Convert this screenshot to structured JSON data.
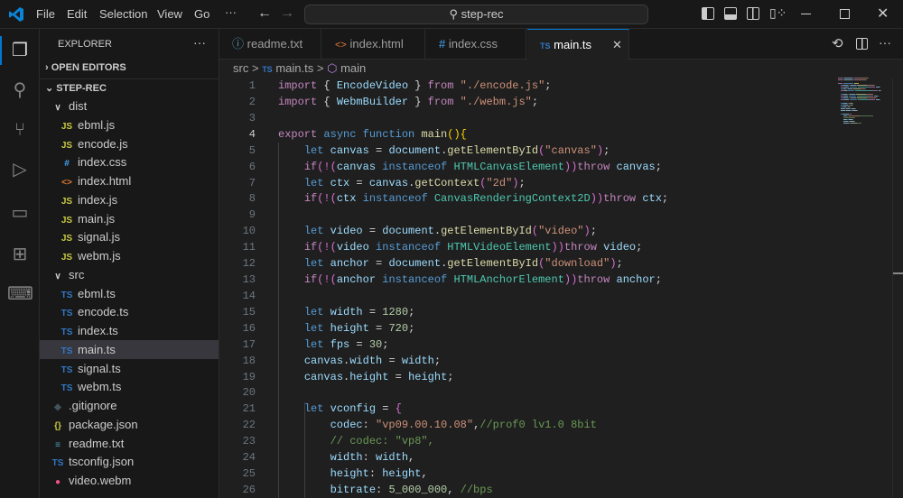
{
  "titlebar": {
    "menus": [
      "File",
      "Edit",
      "Selection",
      "View",
      "Go",
      "···"
    ],
    "search": "step-rec"
  },
  "sidebar": {
    "title": "EXPLORER",
    "more": "···",
    "open_editors": "OPEN EDITORS",
    "project": "STEP-REC",
    "tree": [
      {
        "label": "dist",
        "kind": "folder",
        "depth": 1,
        "icon": "∨"
      },
      {
        "label": "ebml.js",
        "kind": "js",
        "depth": 2,
        "icon": "JS"
      },
      {
        "label": "encode.js",
        "kind": "js",
        "depth": 2,
        "icon": "JS"
      },
      {
        "label": "index.css",
        "kind": "css",
        "depth": 2,
        "icon": "#"
      },
      {
        "label": "index.html",
        "kind": "html",
        "depth": 2,
        "icon": "<>"
      },
      {
        "label": "index.js",
        "kind": "js",
        "depth": 2,
        "icon": "JS"
      },
      {
        "label": "main.js",
        "kind": "js",
        "depth": 2,
        "icon": "JS"
      },
      {
        "label": "signal.js",
        "kind": "js",
        "depth": 2,
        "icon": "JS"
      },
      {
        "label": "webm.js",
        "kind": "js",
        "depth": 2,
        "icon": "JS"
      },
      {
        "label": "src",
        "kind": "folder",
        "depth": 1,
        "icon": "∨"
      },
      {
        "label": "ebml.ts",
        "kind": "ts",
        "depth": 2,
        "icon": "TS"
      },
      {
        "label": "encode.ts",
        "kind": "ts",
        "depth": 2,
        "icon": "TS"
      },
      {
        "label": "index.ts",
        "kind": "ts",
        "depth": 2,
        "icon": "TS"
      },
      {
        "label": "main.ts",
        "kind": "ts",
        "depth": 2,
        "icon": "TS",
        "selected": true
      },
      {
        "label": "signal.ts",
        "kind": "ts",
        "depth": 2,
        "icon": "TS"
      },
      {
        "label": "webm.ts",
        "kind": "ts",
        "depth": 2,
        "icon": "TS"
      },
      {
        "label": ".gitignore",
        "kind": "git",
        "depth": 1,
        "icon": "◆"
      },
      {
        "label": "package.json",
        "kind": "json",
        "depth": 1,
        "icon": "{}"
      },
      {
        "label": "readme.txt",
        "kind": "txt",
        "depth": 1,
        "icon": "≡"
      },
      {
        "label": "tsconfig.json",
        "kind": "tsjson",
        "depth": 1,
        "icon": "TS"
      },
      {
        "label": "video.webm",
        "kind": "video",
        "depth": 1,
        "icon": "●"
      }
    ]
  },
  "tabs": [
    {
      "label": "readme.txt",
      "icon": "ⓘ"
    },
    {
      "label": "index.html",
      "icon": "<>"
    },
    {
      "label": "index.css",
      "icon": "#"
    },
    {
      "label": "main.ts",
      "icon": "TS",
      "active": true,
      "close": "✕"
    }
  ],
  "breadcrumb": {
    "folder": "src",
    "file": "main.ts",
    "symbol": "main",
    "sep": ">"
  },
  "colors": {
    "accent": "#0078d4",
    "js": "#cbcb41",
    "ts": "#3178c6",
    "css": "#42a5f5",
    "html": "#e37933"
  },
  "code": {
    "lines": [
      [
        [
          "c",
          "import"
        ],
        [
          "p",
          " { "
        ],
        [
          "v",
          "EncodeVideo"
        ],
        [
          "p",
          " } "
        ],
        [
          "c",
          "from"
        ],
        [
          "p",
          " "
        ],
        [
          "s",
          "\"./encode.js\""
        ],
        [
          "p",
          ";"
        ]
      ],
      [
        [
          "c",
          "import"
        ],
        [
          "p",
          " { "
        ],
        [
          "v",
          "WebmBuilder"
        ],
        [
          "p",
          " } "
        ],
        [
          "c",
          "from"
        ],
        [
          "p",
          " "
        ],
        [
          "s",
          "\"./webm.js\""
        ],
        [
          "p",
          ";"
        ]
      ],
      [],
      [
        [
          "c",
          "export"
        ],
        [
          "p",
          " "
        ],
        [
          "k",
          "async"
        ],
        [
          "p",
          " "
        ],
        [
          "k",
          "function"
        ],
        [
          "p",
          " "
        ],
        [
          "f",
          "main"
        ],
        [
          "y",
          "()"
        ],
        [
          "y",
          "{"
        ]
      ],
      [
        [
          "p",
          "    "
        ],
        [
          "k",
          "let"
        ],
        [
          "p",
          " "
        ],
        [
          "v",
          "canvas"
        ],
        [
          "p",
          " = "
        ],
        [
          "v",
          "document"
        ],
        [
          "p",
          "."
        ],
        [
          "f",
          "getElementById"
        ],
        [
          "q",
          "("
        ],
        [
          "s",
          "\"canvas\""
        ],
        [
          "q",
          ")"
        ],
        [
          "p",
          ";"
        ]
      ],
      [
        [
          "p",
          "    "
        ],
        [
          "c",
          "if"
        ],
        [
          "q",
          "(!("
        ],
        [
          "v",
          "canvas"
        ],
        [
          "p",
          " "
        ],
        [
          "k",
          "instanceof"
        ],
        [
          "p",
          " "
        ],
        [
          "t",
          "HTMLCanvasElement"
        ],
        [
          "q",
          "))"
        ],
        [
          "c",
          "throw"
        ],
        [
          "p",
          " "
        ],
        [
          "v",
          "canvas"
        ],
        [
          "p",
          ";"
        ]
      ],
      [
        [
          "p",
          "    "
        ],
        [
          "k",
          "let"
        ],
        [
          "p",
          " "
        ],
        [
          "v",
          "ctx"
        ],
        [
          "p",
          " = "
        ],
        [
          "v",
          "canvas"
        ],
        [
          "p",
          "."
        ],
        [
          "f",
          "getContext"
        ],
        [
          "q",
          "("
        ],
        [
          "s",
          "\"2d\""
        ],
        [
          "q",
          ")"
        ],
        [
          "p",
          ";"
        ]
      ],
      [
        [
          "p",
          "    "
        ],
        [
          "c",
          "if"
        ],
        [
          "q",
          "(!("
        ],
        [
          "v",
          "ctx"
        ],
        [
          "p",
          " "
        ],
        [
          "k",
          "instanceof"
        ],
        [
          "p",
          " "
        ],
        [
          "t",
          "CanvasRenderingContext2D"
        ],
        [
          "q",
          "))"
        ],
        [
          "c",
          "throw"
        ],
        [
          "p",
          " "
        ],
        [
          "v",
          "ctx"
        ],
        [
          "p",
          ";"
        ]
      ],
      [],
      [
        [
          "p",
          "    "
        ],
        [
          "k",
          "let"
        ],
        [
          "p",
          " "
        ],
        [
          "v",
          "video"
        ],
        [
          "p",
          " = "
        ],
        [
          "v",
          "document"
        ],
        [
          "p",
          "."
        ],
        [
          "f",
          "getElementById"
        ],
        [
          "q",
          "("
        ],
        [
          "s",
          "\"video\""
        ],
        [
          "q",
          ")"
        ],
        [
          "p",
          ";"
        ]
      ],
      [
        [
          "p",
          "    "
        ],
        [
          "c",
          "if"
        ],
        [
          "q",
          "(!("
        ],
        [
          "v",
          "video"
        ],
        [
          "p",
          " "
        ],
        [
          "k",
          "instanceof"
        ],
        [
          "p",
          " "
        ],
        [
          "t",
          "HTMLVideoElement"
        ],
        [
          "q",
          "))"
        ],
        [
          "c",
          "throw"
        ],
        [
          "p",
          " "
        ],
        [
          "v",
          "video"
        ],
        [
          "p",
          ";"
        ]
      ],
      [
        [
          "p",
          "    "
        ],
        [
          "k",
          "let"
        ],
        [
          "p",
          " "
        ],
        [
          "v",
          "anchor"
        ],
        [
          "p",
          " = "
        ],
        [
          "v",
          "document"
        ],
        [
          "p",
          "."
        ],
        [
          "f",
          "getElementById"
        ],
        [
          "q",
          "("
        ],
        [
          "s",
          "\"download\""
        ],
        [
          "q",
          ")"
        ],
        [
          "p",
          ";"
        ]
      ],
      [
        [
          "p",
          "    "
        ],
        [
          "c",
          "if"
        ],
        [
          "q",
          "(!("
        ],
        [
          "v",
          "anchor"
        ],
        [
          "p",
          " "
        ],
        [
          "k",
          "instanceof"
        ],
        [
          "p",
          " "
        ],
        [
          "t",
          "HTMLAnchorElement"
        ],
        [
          "q",
          "))"
        ],
        [
          "c",
          "throw"
        ],
        [
          "p",
          " "
        ],
        [
          "v",
          "anchor"
        ],
        [
          "p",
          ";"
        ]
      ],
      [],
      [
        [
          "p",
          "    "
        ],
        [
          "k",
          "let"
        ],
        [
          "p",
          " "
        ],
        [
          "v",
          "width"
        ],
        [
          "p",
          " = "
        ],
        [
          "n",
          "1280"
        ],
        [
          "p",
          ";"
        ]
      ],
      [
        [
          "p",
          "    "
        ],
        [
          "k",
          "let"
        ],
        [
          "p",
          " "
        ],
        [
          "v",
          "height"
        ],
        [
          "p",
          " = "
        ],
        [
          "n",
          "720"
        ],
        [
          "p",
          ";"
        ]
      ],
      [
        [
          "p",
          "    "
        ],
        [
          "k",
          "let"
        ],
        [
          "p",
          " "
        ],
        [
          "v",
          "fps"
        ],
        [
          "p",
          " = "
        ],
        [
          "n",
          "30"
        ],
        [
          "p",
          ";"
        ]
      ],
      [
        [
          "p",
          "    "
        ],
        [
          "v",
          "canvas"
        ],
        [
          "p",
          "."
        ],
        [
          "v",
          "width"
        ],
        [
          "p",
          " = "
        ],
        [
          "v",
          "width"
        ],
        [
          "p",
          ";"
        ]
      ],
      [
        [
          "p",
          "    "
        ],
        [
          "v",
          "canvas"
        ],
        [
          "p",
          "."
        ],
        [
          "v",
          "height"
        ],
        [
          "p",
          " = "
        ],
        [
          "v",
          "height"
        ],
        [
          "p",
          ";"
        ]
      ],
      [],
      [
        [
          "p",
          "    "
        ],
        [
          "k",
          "let"
        ],
        [
          "p",
          " "
        ],
        [
          "v",
          "vconfig"
        ],
        [
          "p",
          " = "
        ],
        [
          "q",
          "{"
        ]
      ],
      [
        [
          "p",
          "        "
        ],
        [
          "v",
          "codec"
        ],
        [
          "p",
          ": "
        ],
        [
          "s",
          "\"vp09.00.10.08\""
        ],
        [
          "p",
          ","
        ],
        [
          "m",
          "//prof0 lv1.0 8bit"
        ]
      ],
      [
        [
          "p",
          "        "
        ],
        [
          "m",
          "// codec: \"vp8\","
        ]
      ],
      [
        [
          "p",
          "        "
        ],
        [
          "v",
          "width"
        ],
        [
          "p",
          ": "
        ],
        [
          "v",
          "width"
        ],
        [
          "p",
          ","
        ]
      ],
      [
        [
          "p",
          "        "
        ],
        [
          "v",
          "height"
        ],
        [
          "p",
          ": "
        ],
        [
          "v",
          "height"
        ],
        [
          "p",
          ","
        ]
      ],
      [
        [
          "p",
          "        "
        ],
        [
          "v",
          "bitrate"
        ],
        [
          "p",
          ": "
        ],
        [
          "n",
          "5_000_000"
        ],
        [
          "p",
          ", "
        ],
        [
          "m",
          "//bps"
        ]
      ]
    ]
  }
}
